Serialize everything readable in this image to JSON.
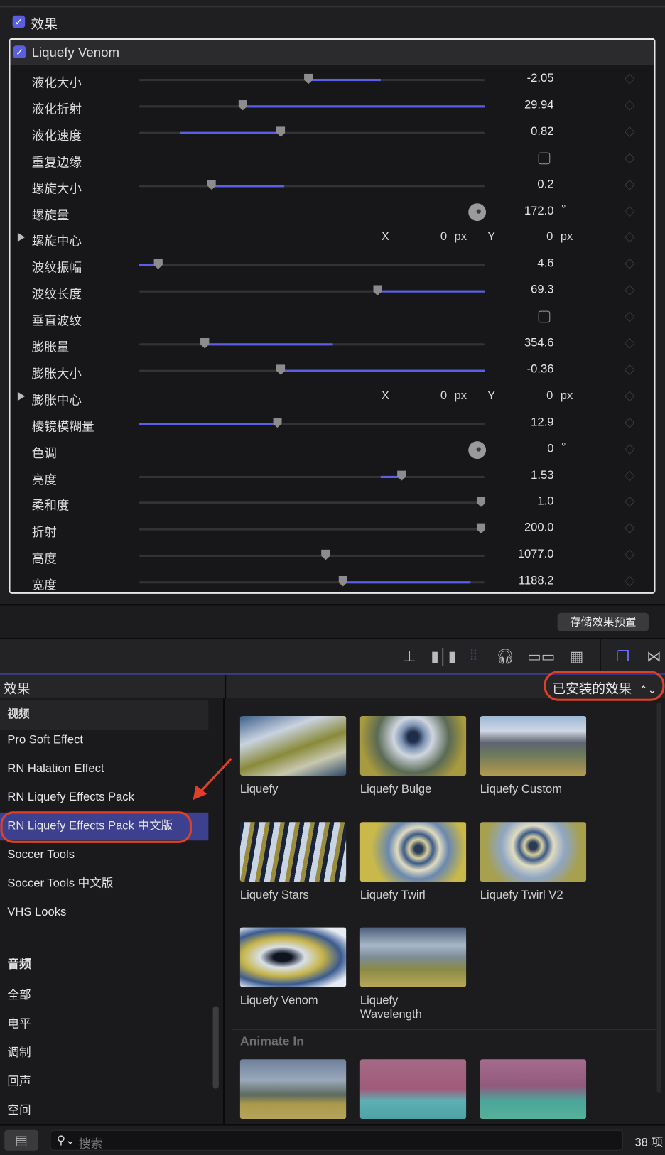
{
  "inspector": {
    "effects_label": "效果",
    "effects_checked": true,
    "effect_name": "Liquefy Venom",
    "effect_checked": true,
    "params": [
      {
        "label": "液化大小",
        "type": "slider",
        "value": "-2.05",
        "knob": 0.49,
        "fill": [
          0.49,
          0.7
        ]
      },
      {
        "label": "液化折射",
        "type": "slider",
        "value": "29.94",
        "knob": 0.3,
        "fill": [
          0.3,
          1
        ]
      },
      {
        "label": "液化速度",
        "type": "slider",
        "value": "0.82",
        "knob": 0.41,
        "fill": [
          0.12,
          0.41
        ]
      },
      {
        "label": "重复边缘",
        "type": "checkbox",
        "checked": false
      },
      {
        "label": "螺旋大小",
        "type": "slider",
        "value": "0.2",
        "knob": 0.21,
        "fill": [
          0.21,
          0.42
        ]
      },
      {
        "label": "螺旋量",
        "type": "dial",
        "value": "172.0",
        "unit": "°"
      },
      {
        "label": "螺旋中心",
        "type": "point",
        "x_label": "X",
        "x": "0",
        "y_label": "Y",
        "y": "0",
        "unit": "px"
      },
      {
        "label": "波纹振幅",
        "type": "slider",
        "value": "4.6",
        "knob": 0.055,
        "fill": [
          0,
          0.055
        ]
      },
      {
        "label": "波纹长度",
        "type": "slider",
        "value": "69.3",
        "knob": 0.69,
        "fill": [
          0.69,
          1
        ]
      },
      {
        "label": "垂直波纹",
        "type": "checkbox",
        "checked": false
      },
      {
        "label": "膨胀量",
        "type": "slider",
        "value": "354.6",
        "knob": 0.19,
        "fill": [
          0.19,
          0.56
        ]
      },
      {
        "label": "膨胀大小",
        "type": "slider",
        "value": "-0.36",
        "knob": 0.41,
        "fill": [
          0.41,
          1
        ]
      },
      {
        "label": "膨胀中心",
        "type": "point",
        "x_label": "X",
        "x": "0",
        "y_label": "Y",
        "y": "0",
        "unit": "px"
      },
      {
        "label": "棱镜模糊量",
        "type": "slider",
        "value": "12.9",
        "knob": 0.4,
        "fill": [
          0,
          0.4
        ]
      },
      {
        "label": "色调",
        "type": "dial",
        "value": "0",
        "unit": "°"
      },
      {
        "label": "亮度",
        "type": "slider",
        "value": "1.53",
        "knob": 0.76,
        "fill": [
          0.7,
          0.76
        ]
      },
      {
        "label": "柔和度",
        "type": "slider",
        "value": "1.0",
        "knob": 0.99,
        "fill": null
      },
      {
        "label": "折射",
        "type": "slider",
        "value": "200.0",
        "knob": 0.99,
        "fill": null
      },
      {
        "label": "高度",
        "type": "slider",
        "value": "1077.0",
        "knob": 0.54,
        "fill": null
      },
      {
        "label": "宽度",
        "type": "slider",
        "value": "1188.2",
        "knob": 0.59,
        "fill": [
          0.59,
          0.96
        ]
      }
    ],
    "save_preset": "存储效果预置"
  },
  "browser": {
    "title": "效果",
    "filter": "已安装的效果",
    "sidebar": {
      "video_header": "视频",
      "video_items": [
        "Pro Soft Effect",
        "RN Halation Effect",
        "RN Liquefy Effects Pack",
        "RN Liquefy Effects Pack 中文版",
        "Soccer Tools",
        "Soccer Tools 中文版",
        "VHS Looks"
      ],
      "selected": 3,
      "audio_items": [
        "音频",
        "全部",
        "电平",
        "调制",
        "回声",
        "空间"
      ]
    },
    "effects": [
      "Liquefy",
      "Liquefy Bulge",
      "Liquefy Custom",
      "Liquefy Stars",
      "Liquefy Twirl",
      "Liquefy Twirl V2",
      "Liquefy Venom",
      "Liquefy Wavelength"
    ],
    "section2": "Animate In",
    "search_placeholder": "搜索",
    "count": "38 项"
  },
  "colors": {
    "accent": "#5a5fe0",
    "annotation": "#e0402a"
  }
}
